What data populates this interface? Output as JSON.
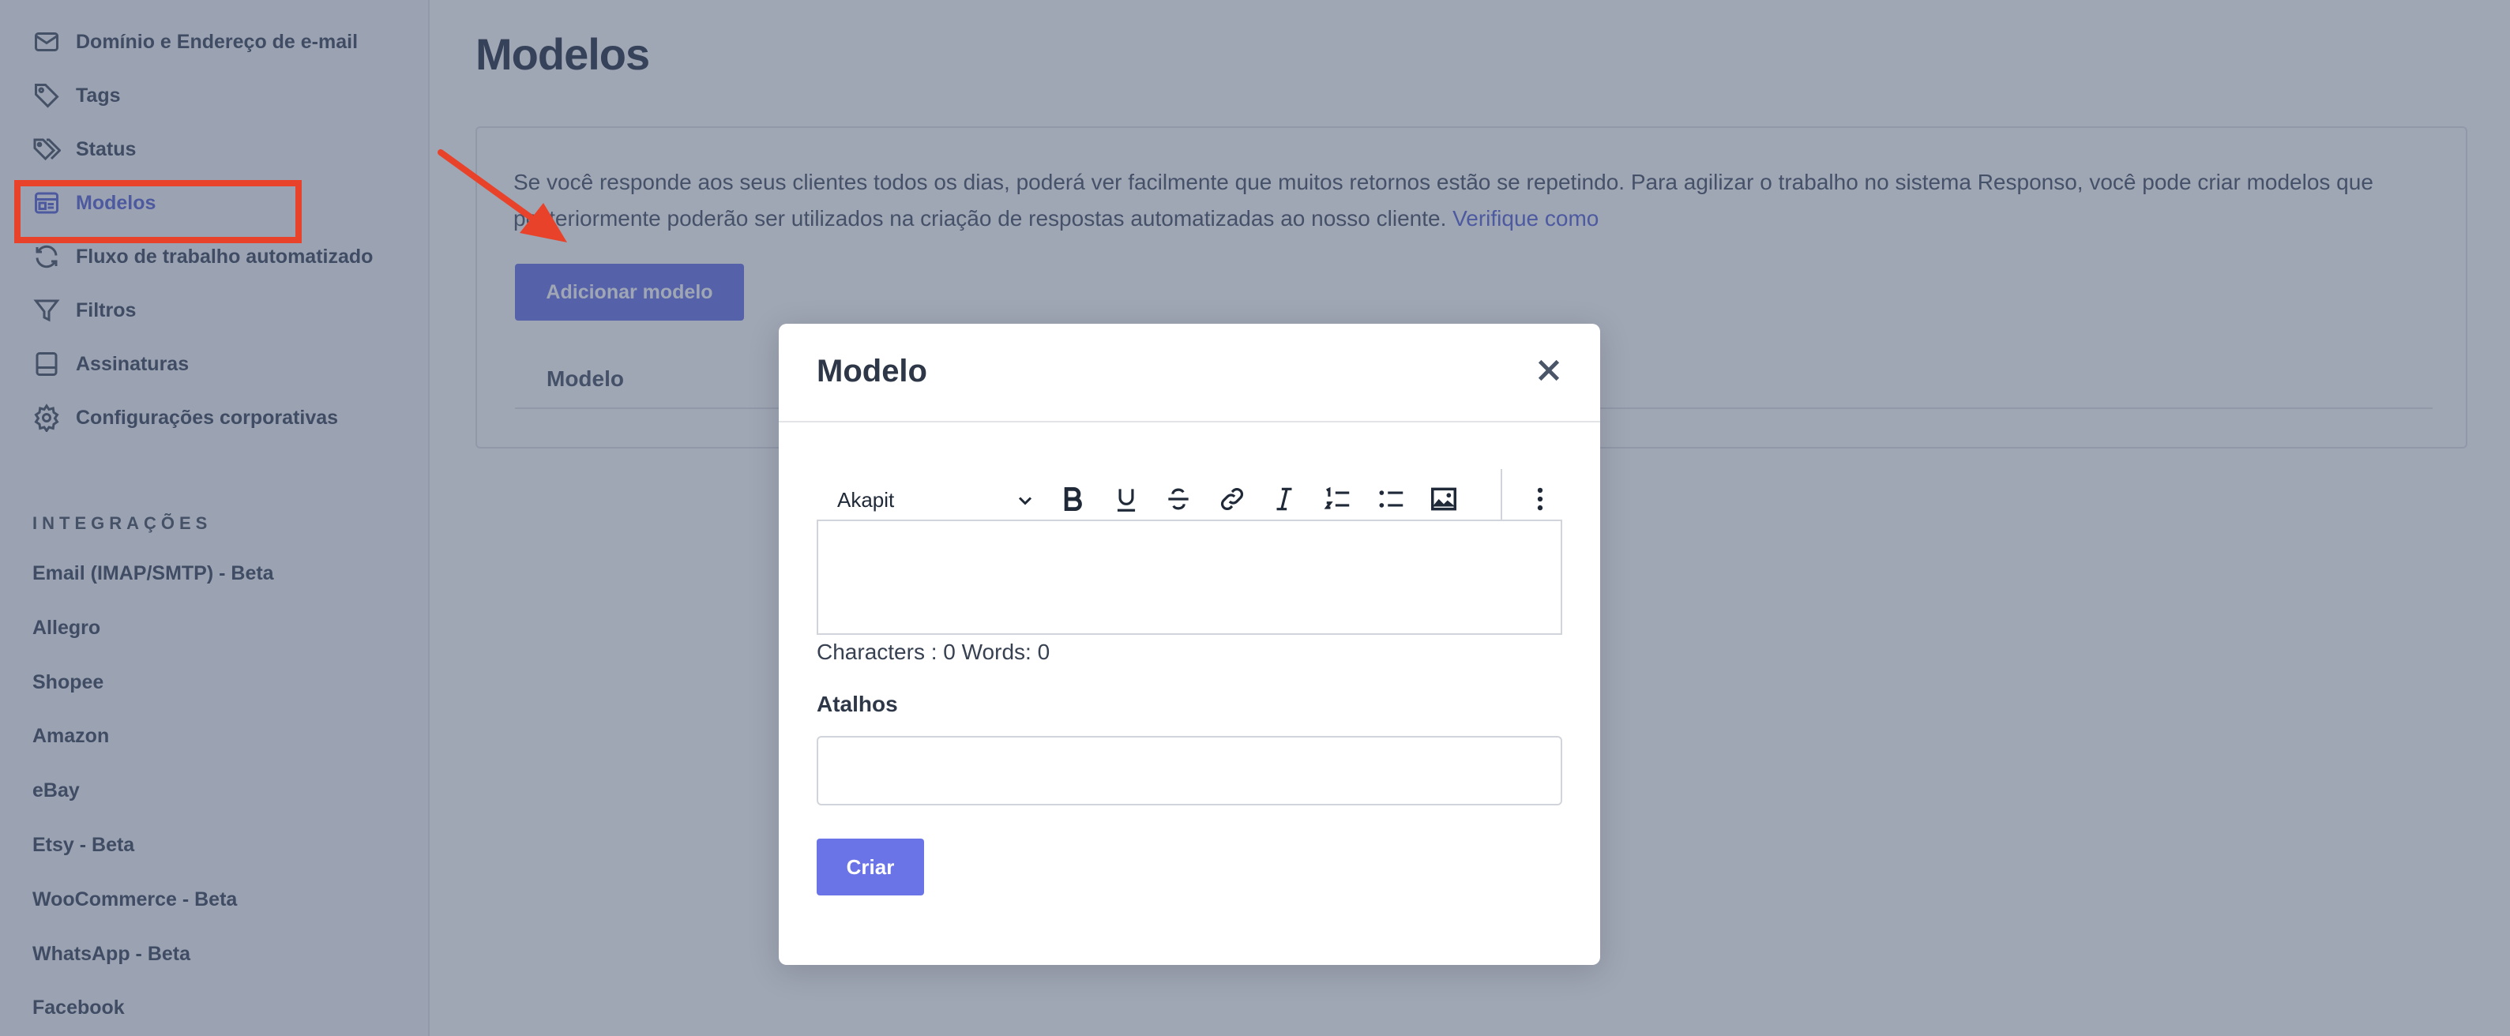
{
  "sidebar": {
    "items": [
      {
        "label": "Domínio e Endereço de e-mail",
        "icon": "mail-icon"
      },
      {
        "label": "Tags",
        "icon": "tag-icon"
      },
      {
        "label": "Status",
        "icon": "tags-icon"
      },
      {
        "label": "Modelos",
        "icon": "template-icon"
      },
      {
        "label": "Fluxo de trabalho automatizado",
        "icon": "refresh-icon"
      },
      {
        "label": "Filtros",
        "icon": "filter-icon"
      },
      {
        "label": "Assinaturas",
        "icon": "signature-icon"
      },
      {
        "label": "Configurações corporativas",
        "icon": "gear-icon"
      }
    ],
    "active_item": "Modelos",
    "integrations_title": "INTEGRAÇÕES",
    "integrations": [
      "Email (IMAP/SMTP) - Beta",
      "Allegro",
      "Shopee",
      "Amazon",
      "eBay",
      "Etsy - Beta",
      "WooCommerce - Beta",
      "WhatsApp - Beta",
      "Facebook"
    ]
  },
  "main": {
    "title": "Modelos",
    "intro_text": "Se você responde aos seus clientes todos os dias, poderá ver facilmente que muitos retornos estão se repetindo. Para agilizar o trabalho no sistema Responso, você pode criar modelos que posteriormente poderão ser utilizados na criação de respostas automatizadas ao nosso cliente. ",
    "intro_link": "Verifique como",
    "add_button": "Adicionar modelo",
    "table_header": "Modelo"
  },
  "modal": {
    "title": "Modelo",
    "font_select": "Akapit",
    "counter": "Characters : 0 Words: 0",
    "shortcuts_label": "Atalhos",
    "shortcuts_value": "",
    "create_button": "Criar"
  },
  "colors": {
    "accent": "#6b74e6",
    "highlight": "#e8432a",
    "overlay": "#3f4e69"
  }
}
